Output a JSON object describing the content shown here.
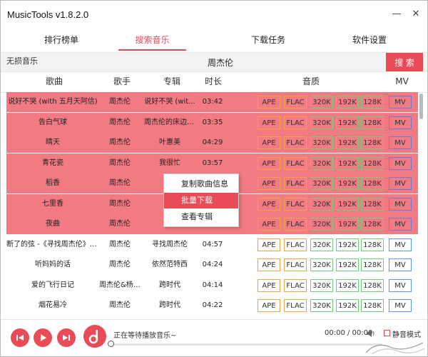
{
  "window": {
    "title": "MusicTools v1.8.2.0",
    "minimize": "—",
    "close": "✕"
  },
  "tabs": [
    {
      "label": "排行榜单"
    },
    {
      "label": "搜索音乐"
    },
    {
      "label": "下载任务"
    },
    {
      "label": "软件设置"
    }
  ],
  "active_tab_color": "#e94b57",
  "search": {
    "quality_label": "无损音乐",
    "query": "周杰伦",
    "button": "搜 索"
  },
  "columns": {
    "song": "歌曲",
    "artist": "歌手",
    "album": "专辑",
    "duration": "时长",
    "quality": "音质",
    "mv": "MV"
  },
  "qualities": [
    "APE",
    "FLAC",
    "320K",
    "192K",
    "128K"
  ],
  "mv_label": "MV",
  "rows": [
    {
      "song": "说好不哭 (with 五月天阿信)",
      "artist": "周杰伦",
      "album": "说好不哭 (wit...",
      "duration": "03:42",
      "selected": true
    },
    {
      "song": "告白气球",
      "artist": "周杰伦",
      "album": "周杰伦的床边故...",
      "duration": "03:35",
      "selected": true
    },
    {
      "song": "晴天",
      "artist": "周杰伦",
      "album": "叶惠美",
      "duration": "04:29",
      "selected": true
    },
    {
      "song": "青花瓷",
      "artist": "周杰伦",
      "album": "我很忙",
      "duration": "03:57",
      "selected": true
    },
    {
      "song": "稻香",
      "artist": "周杰伦",
      "album": "",
      "duration": "",
      "selected": true
    },
    {
      "song": "七里香",
      "artist": "周杰伦",
      "album": "",
      "duration": "",
      "selected": true
    },
    {
      "song": "夜曲",
      "artist": "周杰伦",
      "album": "十一",
      "duration": "",
      "selected": true
    },
    {
      "song": "断了的弦 -《寻找周杰伦》电影插曲",
      "artist": "周杰伦",
      "album": "寻找周杰伦",
      "duration": "04:57",
      "selected": false
    },
    {
      "song": "听妈妈的话",
      "artist": "周杰伦",
      "album": "依然范特西",
      "duration": "04:24",
      "selected": false
    },
    {
      "song": "爱的飞行日记",
      "artist": "周杰伦&杨瑞代",
      "album": "跨时代",
      "duration": "04:14",
      "selected": false
    },
    {
      "song": "烟花易冷",
      "artist": "周杰伦",
      "album": "跨时代",
      "duration": "04:22",
      "selected": false
    }
  ],
  "selection_color": "#f27a83",
  "context_menu": [
    {
      "label": "复制歌曲信息",
      "highlighted": false
    },
    {
      "label": "批量下载",
      "highlighted": true
    },
    {
      "label": "查看专辑",
      "highlighted": false
    }
  ],
  "player": {
    "status": "正在等待播放音乐~",
    "time": "00:00 / 00:00",
    "mute_label": "静音模式",
    "progress_fraction": 0
  },
  "icons": {
    "prev": "prev-track-icon",
    "play": "play-icon",
    "next": "next-track-icon",
    "logo": "music-note-logo-icon",
    "volume": "volume-icon",
    "close": "close-icon",
    "minimize": "minimize-icon"
  }
}
